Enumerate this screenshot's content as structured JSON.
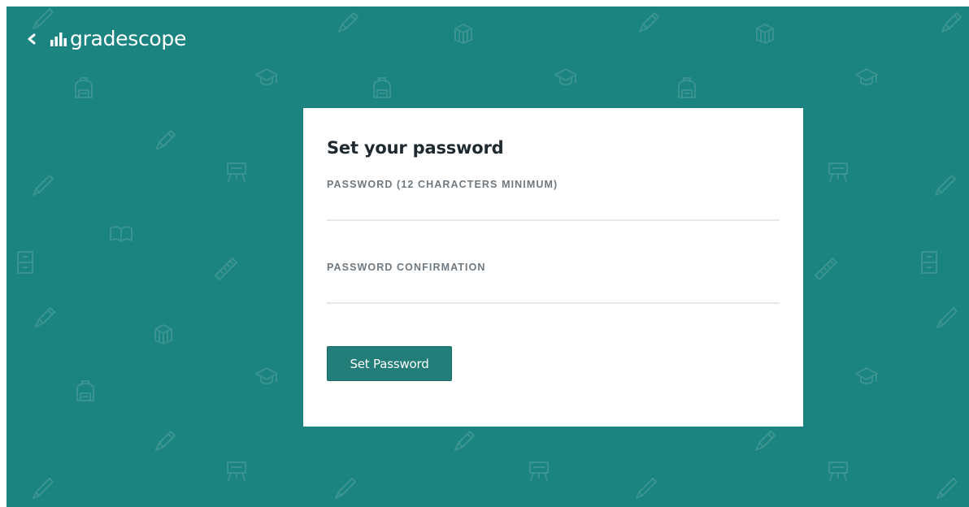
{
  "header": {
    "back_icon": "chevron-left-icon",
    "logo_icon": "bar-chart-icon",
    "logo_text": "gradescope"
  },
  "form": {
    "title": "Set your password",
    "password_label": "PASSWORD (12 CHARACTERS MINIMUM)",
    "password_value": "",
    "confirmation_label": "PASSWORD CONFIRMATION",
    "confirmation_value": "",
    "submit_label": "Set Password"
  },
  "colors": {
    "background": "#1c8480",
    "card": "#ffffff",
    "button": "#237d78",
    "title_text": "#1f2a30",
    "label_text": "#6f787e",
    "input_underline": "#e5e7e9"
  },
  "background_pattern": {
    "icons": [
      "pencil-icon",
      "backpack-icon",
      "books-icon",
      "graduation-cap-icon",
      "easel-icon",
      "open-book-icon",
      "ruler-icon",
      "cabinet-icon",
      "pen-icon"
    ]
  }
}
